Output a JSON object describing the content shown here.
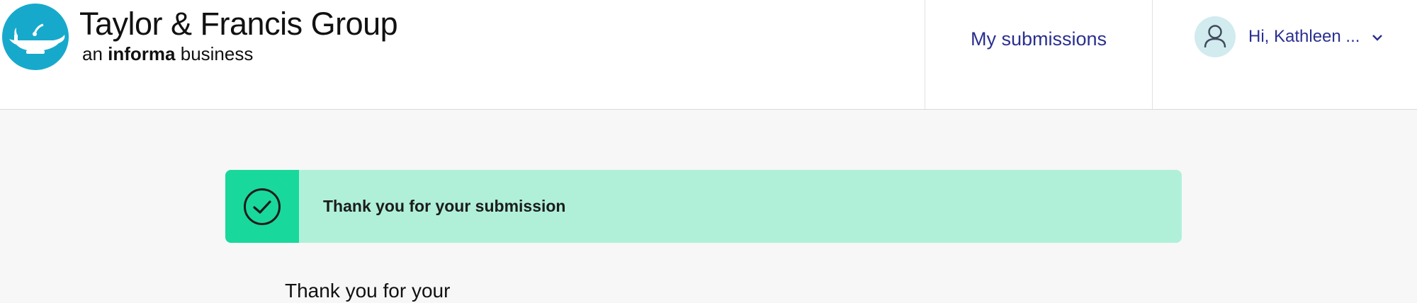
{
  "header": {
    "brand_name": "Taylor & Francis Group",
    "brand_sub_prefix": "an",
    "brand_sub_bold": "informa",
    "brand_sub_suffix": "business",
    "logo_icon": "oil-lamp-icon",
    "nav": {
      "my_submissions_label": "My submissions"
    },
    "user": {
      "greeting": "Hi, Kathleen ...",
      "avatar_icon": "user-icon",
      "dropdown_icon": "chevron-down-icon"
    }
  },
  "alert": {
    "message": "Thank you for your submission",
    "icon": "check-circle-icon"
  },
  "main": {
    "partial_heading": "Thank you for your"
  },
  "colors": {
    "brand_blue": "#17a9cc",
    "link_navy": "#2a2f8f",
    "alert_bg": "#b0f0d9",
    "alert_accent": "#19d89b",
    "page_bg": "#f7f7f7"
  }
}
